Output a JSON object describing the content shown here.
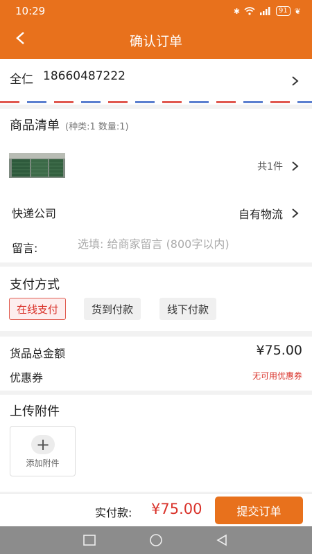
{
  "status_bar": {
    "time": "10:29",
    "battery": "91"
  },
  "header": {
    "title": "确认订单"
  },
  "address": {
    "name": "全仁",
    "phone": "18660487222"
  },
  "goods": {
    "title": "商品清单",
    "summary": "(种类:1 数量:1)",
    "count_text": "共1件",
    "express_label": "快递公司",
    "express_value": "自有物流",
    "message_label": "留言:",
    "message_placeholder": "选填: 给商家留言 (800字以内)"
  },
  "payment": {
    "title": "支付方式",
    "options": [
      "在线支付",
      "货到付款",
      "线下付款"
    ],
    "selected": "在线支付"
  },
  "amount": {
    "total_label": "货品总金额",
    "total_value": "¥75.00",
    "coupon_label": "优惠券",
    "coupon_value": "无可用优惠券"
  },
  "upload": {
    "title": "上传附件",
    "add_label": "添加附件"
  },
  "bottom_bar": {
    "pay_label": "实付款:",
    "pay_total": "¥75.00",
    "submit_label": "提交订单"
  },
  "colors": {
    "accent": "#e8711c",
    "price_red": "#d9322a"
  }
}
